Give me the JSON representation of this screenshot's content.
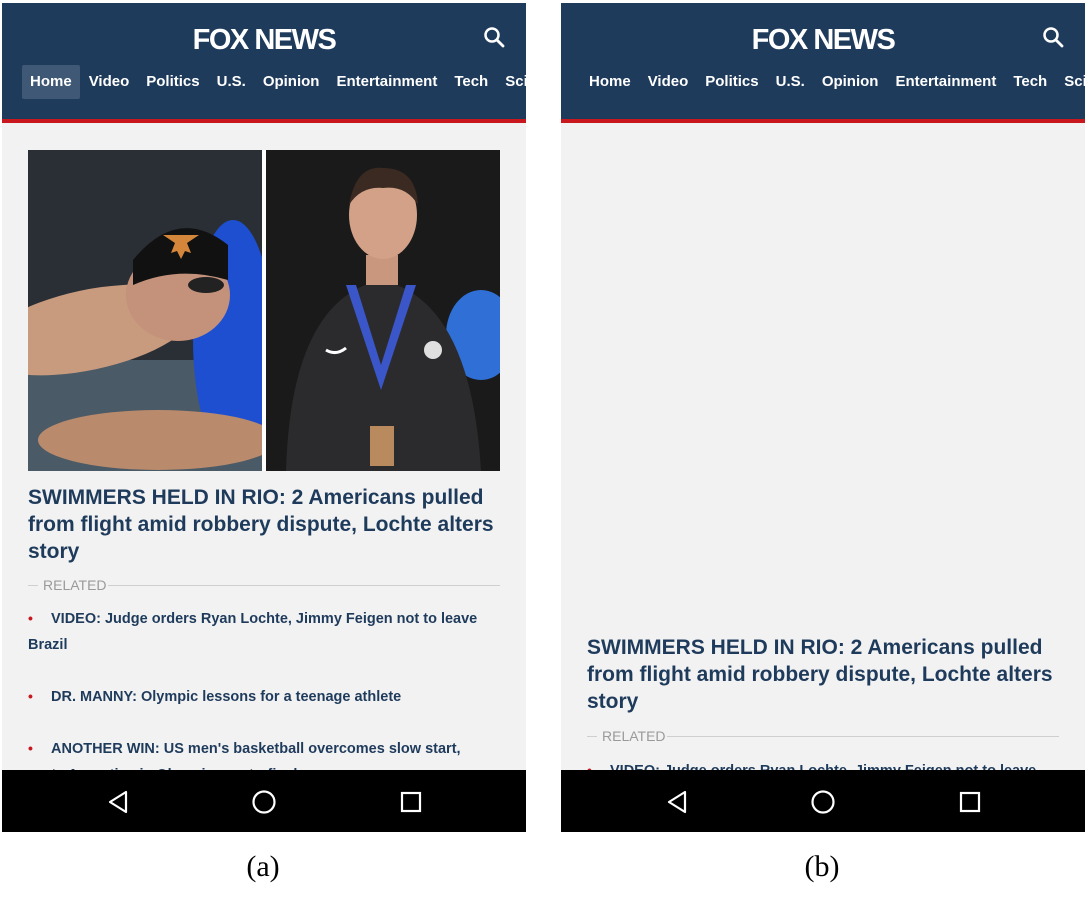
{
  "colors": {
    "header_bg": "#1f3b5c",
    "accent_red": "#c8181e",
    "page_bg": "#f2f2f2",
    "headline_text": "#1f3b5c",
    "system_bar": "#000000"
  },
  "header": {
    "logo_text": "FOX NEWS",
    "search_icon": "search-icon",
    "nav_items": [
      "Home",
      "Video",
      "Politics",
      "U.S.",
      "Opinion",
      "Entertainment",
      "Tech",
      "Sci"
    ],
    "active_item": "Home"
  },
  "article": {
    "headline": "SWIMMERS HELD IN RIO: 2 Americans pulled from flight amid robbery dispute, Lochte alters story",
    "related_label": "RELATED",
    "related_items": [
      "VIDEO: Judge orders Ryan Lochte, Jimmy Feigen not to leave Brazil",
      "DR. MANNY: Olympic lessons for a teenage athlete",
      "ANOTHER WIN: US men's basketball overcomes slow start, routs Argentina in Olympic quarterfinals"
    ]
  },
  "system_nav": {
    "back_icon": "back-triangle-icon",
    "home_icon": "home-circle-icon",
    "recents_icon": "recents-square-icon"
  },
  "captions": {
    "a": "(a)",
    "b": "(b)"
  }
}
